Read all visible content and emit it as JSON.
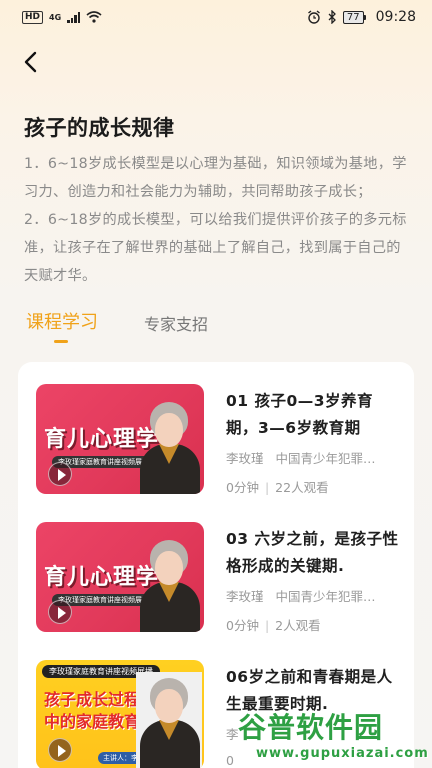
{
  "status_bar": {
    "hd": "HD",
    "network": "4G",
    "battery": "77",
    "time": "09:28"
  },
  "page": {
    "title": "孩子的成长规律",
    "description": "1．6~18岁成长模型是以心理为基础，知识领域为基地，学习力、创造力和社会能力为辅助，共同帮助孩子成长；\n2．6~18岁的成长模型，可以给我们提供评价孩子的多元标准，让孩子在了解世界的基础上了解自己，找到属于自己的天赋才华。"
  },
  "tabs": [
    {
      "label": "课程学习",
      "active": true
    },
    {
      "label": "专家支招",
      "active": false
    }
  ],
  "courses": [
    {
      "thumb_title": "育儿心理学",
      "thumb_sub": "李玫瑾家庭教育讲座视频展播",
      "title": "01 孩子0—3岁养育期，3—6岁教育期",
      "author": "李玫瑾",
      "org": "中国青少年犯罪…",
      "duration": "0分钟",
      "views": "22人观看"
    },
    {
      "thumb_title": "育儿心理学",
      "thumb_sub": "李玫瑾家庭教育讲座视频展播",
      "title": "03 六岁之前，是孩子性格形成的关键期.",
      "author": "李玫瑾",
      "org": "中国青少年犯罪…",
      "duration": "0分钟",
      "views": "2人观看"
    },
    {
      "thumb_banner": "李玫瑾家庭教育讲座视频展播",
      "thumb_title_line1": "孩子成长过程",
      "thumb_title_line2": "中的家庭教育",
      "thumb_speaker": "主讲人：李玫瑾",
      "title": "06岁之前和青春期是人生最重要时期.",
      "author": "李",
      "duration": "0"
    }
  ],
  "watermark": {
    "cn": "谷普软件园",
    "en": "www.gupuxiazai.com"
  },
  "colors": {
    "accent": "#f0a21a",
    "thumb_pink": "#e23a5b",
    "thumb_yellow": "#ffc21a",
    "watermark_green": "#2ea043"
  }
}
